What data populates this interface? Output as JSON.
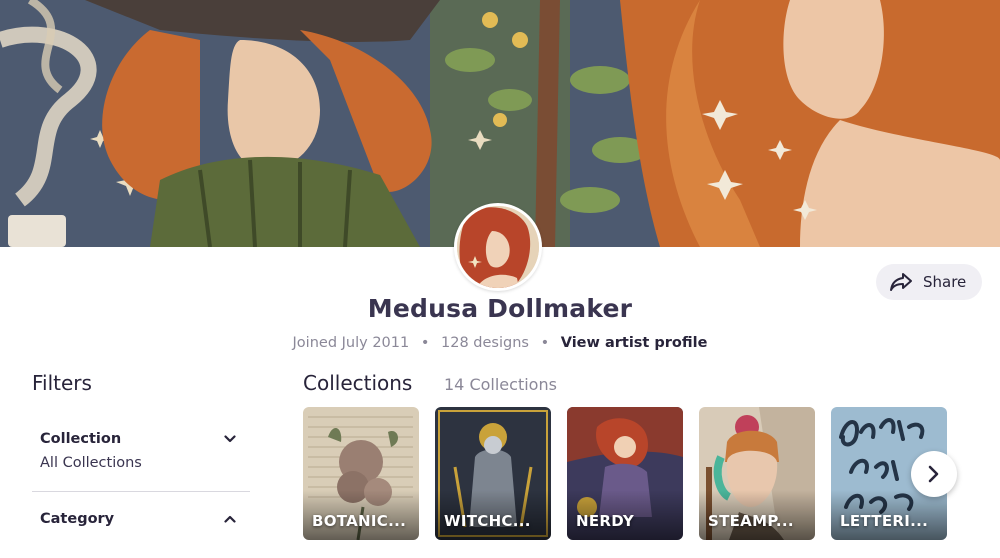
{
  "profile": {
    "name": "Medusa Dollmaker",
    "joined": "Joined July 2011",
    "designs": "128 designs",
    "view_profile": "View artist profile",
    "share_label": "Share"
  },
  "filters": {
    "title": "Filters",
    "collection": {
      "label": "Collection",
      "value": "All Collections"
    },
    "category": {
      "label": "Category"
    }
  },
  "collections": {
    "title": "Collections",
    "count": "14 Collections",
    "items": [
      {
        "label": "BOTANIC..."
      },
      {
        "label": "WITCHC..."
      },
      {
        "label": "NERDY"
      },
      {
        "label": "STEAMP..."
      },
      {
        "label": "LETTERI..."
      }
    ]
  },
  "icons": {
    "share": "share-arrow-icon",
    "collection_toggle": "chevron-down-icon",
    "category_toggle": "chevron-up-icon",
    "carousel_next": "chevron-right-icon"
  },
  "colors": {
    "text_primary": "#28243a",
    "text_muted": "#8b8898",
    "share_bg": "#f0eff4",
    "banner_sky": "#4b5a73",
    "hair_orange": "#c9682f"
  }
}
